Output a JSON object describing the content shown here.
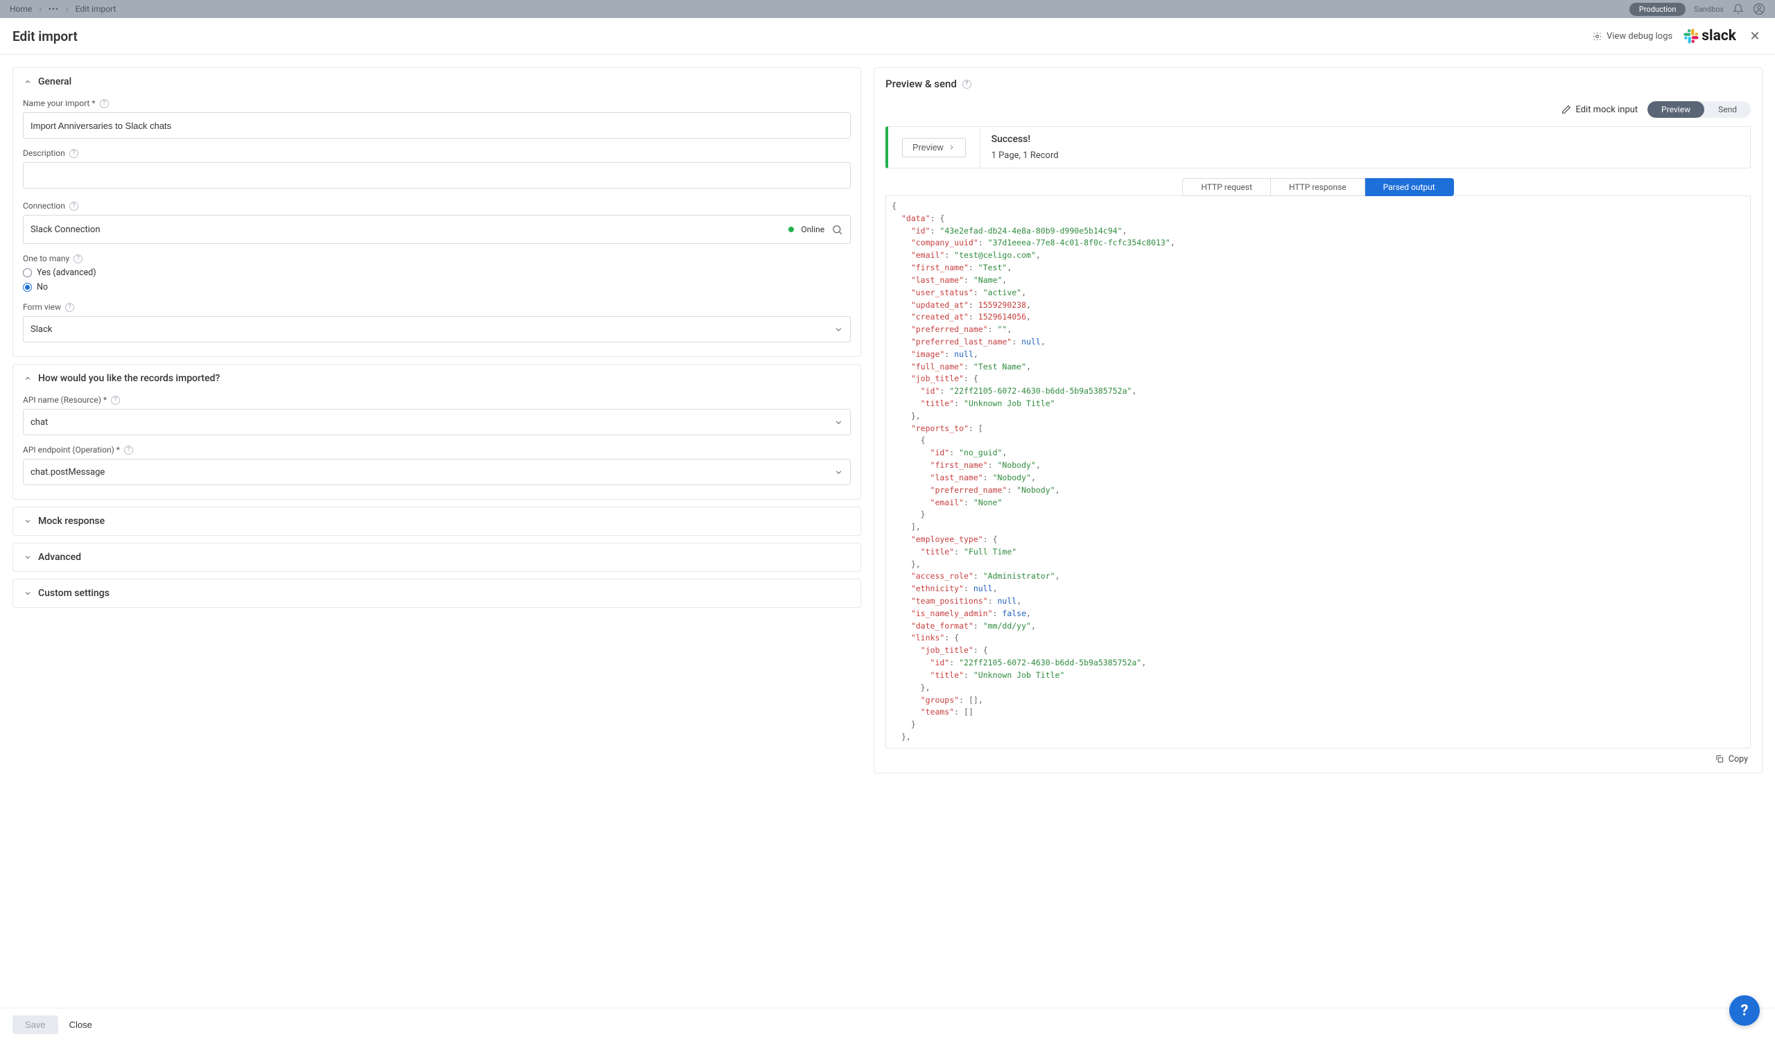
{
  "breadcrumb": {
    "home": "Home",
    "current": "Edit import"
  },
  "env": {
    "production": "Production",
    "sandbox": "Sandbox"
  },
  "header": {
    "title": "Edit import",
    "debug": "View debug logs",
    "brand": "slack"
  },
  "general": {
    "title": "General",
    "name_label": "Name your import *",
    "name_value": "Import Anniversaries to Slack chats",
    "desc_label": "Description",
    "desc_value": "",
    "conn_label": "Connection",
    "conn_value": "Slack Connection",
    "conn_status": "Online",
    "otm_label": "One to many",
    "otm_yes": "Yes (advanced)",
    "otm_no": "No",
    "formview_label": "Form view",
    "formview_value": "Slack"
  },
  "records": {
    "title": "How would you like the records imported?",
    "api_name_label": "API name (Resource) *",
    "api_name_value": "chat",
    "api_endpoint_label": "API endpoint (Operation) *",
    "api_endpoint_value": "chat.postMessage"
  },
  "sections": {
    "mock": "Mock response",
    "advanced": "Advanced",
    "custom": "Custom settings"
  },
  "preview": {
    "title": "Preview & send",
    "edit_mock": "Edit mock input",
    "pill_preview": "Preview",
    "pill_send": "Send",
    "preview_btn": "Preview",
    "success": "Success!",
    "page_record": "1 Page, 1 Record",
    "tab_req": "HTTP request",
    "tab_resp": "HTTP response",
    "tab_parsed": "Parsed output",
    "copy": "Copy"
  },
  "footer": {
    "save": "Save",
    "close": "Close"
  },
  "parsed_output": {
    "data": {
      "id": "43e2efad-db24-4e8a-80b9-d990e5b14c94",
      "company_uuid": "37d1eeea-77e8-4c01-8f0c-fcfc354c8013",
      "email": "test@celigo.com",
      "first_name": "Test",
      "last_name": "Name",
      "user_status": "active",
      "updated_at": 1559290238,
      "created_at": 1529614056,
      "preferred_name": "",
      "preferred_last_name": null,
      "image": null,
      "full_name": "Test Name",
      "job_title": {
        "id": "22ff2105-6072-4630-b6dd-5b9a5385752a",
        "title": "Unknown Job Title"
      },
      "reports_to": [
        {
          "id": "no_guid",
          "first_name": "Nobody",
          "last_name": "Nobody",
          "preferred_name": "Nobody",
          "email": "None"
        }
      ],
      "employee_type": {
        "title": "Full Time"
      },
      "access_role": "Administrator",
      "ethnicity": null,
      "team_positions": null,
      "is_namely_admin": false,
      "date_format": "mm/dd/yy",
      "links": {
        "job_title": {
          "id": "22ff2105-6072-4630-b6dd-5b9a5385752a",
          "title": "Unknown Job Title"
        },
        "groups": [],
        "teams": []
      }
    }
  }
}
